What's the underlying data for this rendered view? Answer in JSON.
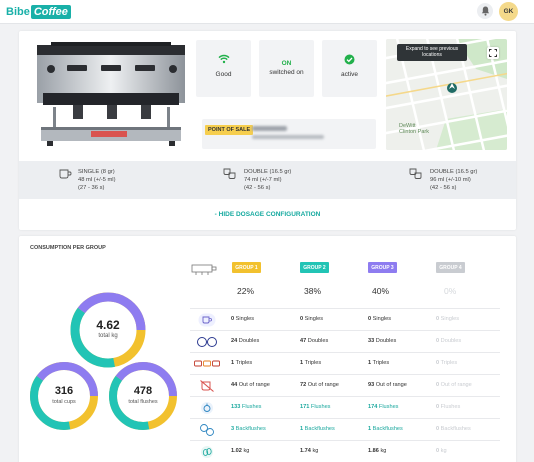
{
  "header": {
    "logo_part1": "Bibe",
    "logo_part2": "Coffee",
    "avatar_initials": "GK"
  },
  "machine": {
    "status": [
      {
        "icon": "wifi-icon",
        "title": "",
        "label": "Good"
      },
      {
        "icon": "power-icon",
        "title": "ON",
        "label": "switched on"
      },
      {
        "icon": "check-circle-icon",
        "title": "",
        "label": "active"
      }
    ],
    "point_of_sale_label": "POINT OF SALE",
    "map_tooltip": "Expand to see previous locations",
    "map_label_1": "DeWitt",
    "map_label_2": "Clinton Park"
  },
  "dosage": [
    {
      "name": "SINGLE (8 gr)",
      "volume": "48 ml (+/-5 ml)",
      "time": "(27 - 36 s)"
    },
    {
      "name": "DOUBLE (16.5 gr)",
      "volume": "74 ml (+/-7 ml)",
      "time": "(42 - 56 s)"
    },
    {
      "name": "DOUBLE (16.5 gr)",
      "volume": "96 ml (+/-10 ml)",
      "time": "(42 - 56 s)"
    }
  ],
  "hide_dosage_label": "- HIDE DOSAGE CONFIGURATION",
  "consumption": {
    "title": "CONSUMPTION PER GROUP",
    "totals": {
      "kg": {
        "value": "4.62",
        "label": "total kg"
      },
      "cups": {
        "value": "316",
        "label": "total cups"
      },
      "flushes": {
        "value": "478",
        "label": "total flushes"
      }
    },
    "groups": [
      {
        "name": "GROUP 1",
        "color": "#f2c12e",
        "pct": "22%"
      },
      {
        "name": "GROUP 2",
        "color": "#22c4b5",
        "pct": "38%"
      },
      {
        "name": "GROUP 3",
        "color": "#8e7cf0",
        "pct": "40%"
      },
      {
        "name": "GROUP 4",
        "color": "#c9ccd1",
        "pct": "0%"
      }
    ],
    "rows": [
      {
        "icon": "single-cup-icon",
        "cells": [
          {
            "n": "0",
            "t": " Singles"
          },
          {
            "n": "0",
            "t": " Singles"
          },
          {
            "n": "0",
            "t": " Singles"
          },
          {
            "n": "0",
            "t": " Singles"
          }
        ]
      },
      {
        "icon": "double-cup-icon",
        "cells": [
          {
            "n": "24",
            "t": " Doubles"
          },
          {
            "n": "47",
            "t": " Doubles"
          },
          {
            "n": "33",
            "t": " Doubles"
          },
          {
            "n": "0",
            "t": " Doubles"
          }
        ]
      },
      {
        "icon": "triple-cup-icon",
        "cells": [
          {
            "n": "1",
            "t": " Triples"
          },
          {
            "n": "1",
            "t": " Triples"
          },
          {
            "n": "1",
            "t": " Triples"
          },
          {
            "n": "0",
            "t": " Triples"
          }
        ]
      },
      {
        "icon": "out-of-range-icon",
        "cells": [
          {
            "n": "44",
            "t": " Out of range"
          },
          {
            "n": "72",
            "t": " Out of range"
          },
          {
            "n": "93",
            "t": " Out of range"
          },
          {
            "n": "0",
            "t": " Out of range"
          }
        ]
      },
      {
        "icon": "flush-icon",
        "cells": [
          {
            "n": "133",
            "t": " Flushes"
          },
          {
            "n": "171",
            "t": " Flushes"
          },
          {
            "n": "174",
            "t": " Flushes"
          },
          {
            "n": "0",
            "t": " Flushes"
          }
        ]
      },
      {
        "icon": "backflush-icon",
        "cells": [
          {
            "n": "3",
            "t": " Backflushes"
          },
          {
            "n": "1",
            "t": " Backflushes"
          },
          {
            "n": "1",
            "t": " Backflushes"
          },
          {
            "n": "0",
            "t": " Backflushes"
          }
        ]
      },
      {
        "icon": "coffee-beans-icon",
        "cells": [
          {
            "n": "1.02",
            "t": " kg"
          },
          {
            "n": "1.74",
            "t": " kg"
          },
          {
            "n": "1.86",
            "t": " kg"
          },
          {
            "n": "0",
            "t": " kg"
          }
        ]
      }
    ]
  }
}
